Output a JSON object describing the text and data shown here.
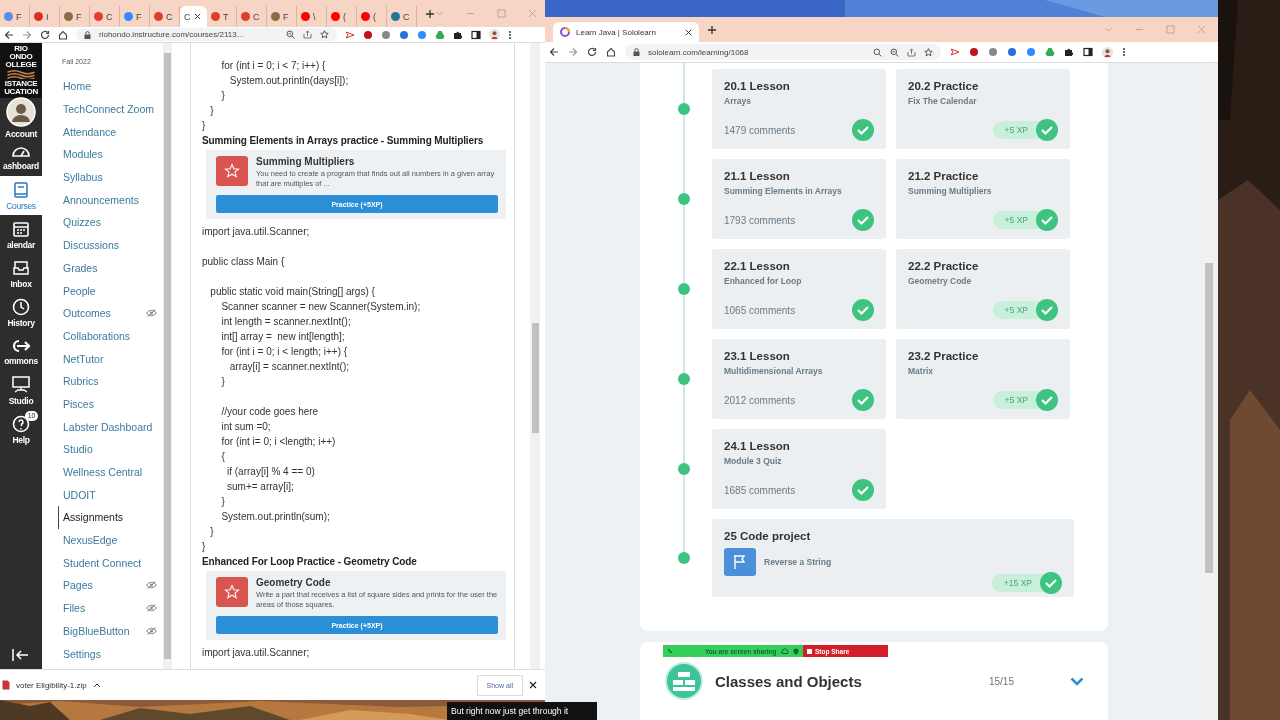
{
  "left_window": {
    "tabs": [
      {
        "title": "F",
        "selected": false,
        "color": "#5b8def"
      },
      {
        "title": "I",
        "selected": false,
        "color": "#d93025"
      },
      {
        "title": "F",
        "selected": false,
        "color": "#8a6d4a"
      },
      {
        "title": "C",
        "selected": false,
        "color": "#e03e2d"
      },
      {
        "title": "F",
        "selected": false,
        "color": "#2d8cff"
      },
      {
        "title": "C",
        "selected": false,
        "color": "#e03e2d"
      },
      {
        "title": "C",
        "selected": true
      },
      {
        "title": "T",
        "selected": false,
        "color": "#e03e2d"
      },
      {
        "title": "C",
        "selected": false,
        "color": "#e03e2d"
      },
      {
        "title": "F",
        "selected": false,
        "color": "#8a6d4a"
      },
      {
        "title": "\\",
        "selected": false,
        "color": "#ff0000"
      },
      {
        "title": "(",
        "selected": false,
        "color": "#ff0000"
      },
      {
        "title": "(",
        "selected": false,
        "color": "#ff0000"
      },
      {
        "title": "C",
        "selected": false,
        "color": "#21759b"
      }
    ],
    "address": "riohondo.instructure.com/courses/2113...",
    "global_nav": {
      "logo_top": [
        "RIO",
        "ONDO",
        "OLLEGE"
      ],
      "logo_bottom": [
        "ISTANCE",
        "UCATION"
      ],
      "items": [
        {
          "label": "Account",
          "selected": false
        },
        {
          "label": "ashboard",
          "selected": false
        },
        {
          "label": "Courses",
          "selected": true
        },
        {
          "label": "alendar",
          "selected": false
        },
        {
          "label": "Inbox",
          "selected": false
        },
        {
          "label": "History",
          "selected": false
        },
        {
          "label": "ommons",
          "selected": false
        },
        {
          "label": "Studio",
          "selected": false
        },
        {
          "label": "Help",
          "selected": false,
          "badge": "10"
        }
      ]
    },
    "course_nav": {
      "term": "Fall 2022",
      "items": [
        {
          "label": "Home",
          "selected": false,
          "hidden": false
        },
        {
          "label": "TechConnect Zoom",
          "selected": false,
          "hidden": false
        },
        {
          "label": "Attendance",
          "selected": false,
          "hidden": false
        },
        {
          "label": "Modules",
          "selected": false,
          "hidden": false
        },
        {
          "label": "Syllabus",
          "selected": false,
          "hidden": false
        },
        {
          "label": "Announcements",
          "selected": false,
          "hidden": false
        },
        {
          "label": "Quizzes",
          "selected": false,
          "hidden": false
        },
        {
          "label": "Discussions",
          "selected": false,
          "hidden": false
        },
        {
          "label": "Grades",
          "selected": false,
          "hidden": false
        },
        {
          "label": "People",
          "selected": false,
          "hidden": false
        },
        {
          "label": "Outcomes",
          "selected": false,
          "hidden": true
        },
        {
          "label": "Collaborations",
          "selected": false,
          "hidden": false
        },
        {
          "label": "NetTutor",
          "selected": false,
          "hidden": false
        },
        {
          "label": "Rubrics",
          "selected": false,
          "hidden": false
        },
        {
          "label": "Pisces",
          "selected": false,
          "hidden": false
        },
        {
          "label": "Labster Dashboard",
          "selected": false,
          "hidden": false
        },
        {
          "label": "Studio",
          "selected": false,
          "hidden": false
        },
        {
          "label": "Wellness Central",
          "selected": false,
          "hidden": false
        },
        {
          "label": "UDOIT",
          "selected": false,
          "hidden": false
        },
        {
          "label": "Assignments",
          "selected": true,
          "hidden": false
        },
        {
          "label": "NexusEdge",
          "selected": false,
          "hidden": false
        },
        {
          "label": "Student Connect",
          "selected": false,
          "hidden": false
        },
        {
          "label": "Pages",
          "selected": false,
          "hidden": true
        },
        {
          "label": "Files",
          "selected": false,
          "hidden": true
        },
        {
          "label": "BigBlueButton",
          "selected": false,
          "hidden": true
        },
        {
          "label": "Settings",
          "selected": false,
          "hidden": false
        }
      ]
    },
    "content": [
      {
        "kind": "code",
        "text": "       for (int i = 0; i < 7; i++) {"
      },
      {
        "kind": "code",
        "text": "          System.out.println(days[i]);"
      },
      {
        "kind": "code",
        "text": "       }"
      },
      {
        "kind": "code",
        "text": "   }"
      },
      {
        "kind": "code",
        "text": "}"
      },
      {
        "kind": "heading",
        "text": "Summing Elements in Arrays  practice - Summing Multipliers"
      },
      {
        "kind": "card",
        "title": "Summing Multipliers",
        "description": "You need to create a program that finds out all numbers in a given array that are multiples of ...",
        "button": "Practice (+5XP)"
      },
      {
        "kind": "code",
        "text": "import java.util.Scanner;"
      },
      {
        "kind": "blank"
      },
      {
        "kind": "code",
        "text": "public class Main {"
      },
      {
        "kind": "blank"
      },
      {
        "kind": "code",
        "text": "   public static void main(String[] args) {"
      },
      {
        "kind": "code",
        "text": "       Scanner scanner = new Scanner(System.in);"
      },
      {
        "kind": "code",
        "text": "       int length = scanner.nextInt();"
      },
      {
        "kind": "code",
        "text": "       int[] array =  new int[length];"
      },
      {
        "kind": "code",
        "text": "       for (int i = 0; i < length; i++) {"
      },
      {
        "kind": "code",
        "text": "          array[i] = scanner.nextInt();"
      },
      {
        "kind": "code",
        "text": "       }"
      },
      {
        "kind": "blank"
      },
      {
        "kind": "code",
        "text": "       //your code goes here"
      },
      {
        "kind": "code",
        "text": "       int sum =0;"
      },
      {
        "kind": "code",
        "text": "       for (int i= 0; i <length; i++)"
      },
      {
        "kind": "code",
        "text": "       {"
      },
      {
        "kind": "code",
        "text": "         if (array[i] % 4 == 0)"
      },
      {
        "kind": "code",
        "text": "         sum+= array[i];"
      },
      {
        "kind": "code",
        "text": "       }"
      },
      {
        "kind": "code",
        "text": "       System.out.println(sum);"
      },
      {
        "kind": "code",
        "text": "   }"
      },
      {
        "kind": "code",
        "text": "}"
      },
      {
        "kind": "heading",
        "text": "Enhanced For Loop Practice   - Geometry Code"
      },
      {
        "kind": "card",
        "title": "Geometry Code",
        "description": "Write a part that receives a list of square sides and prints for the user the areas of those squares.",
        "button": "Practice (+5XP)"
      },
      {
        "kind": "code",
        "text": "import java.util.Scanner;"
      }
    ],
    "download_bar": {
      "file": "voter Eligibility-1.zip",
      "show_all": "Show all"
    }
  },
  "right_window": {
    "tab": {
      "title": "Learn Java | Sololearn"
    },
    "address": "sololearn.com/learning/1068",
    "rows": [
      {
        "cards": [
          {
            "kind": "lesson",
            "title": "20.1 Lesson",
            "subtitle": "Arrays",
            "comments": "1479 comments",
            "completed": true
          },
          {
            "kind": "practice",
            "title": "20.2 Practice",
            "subtitle": "Fix The Calendar",
            "xp": "+5 XP",
            "completed": true
          }
        ]
      },
      {
        "cards": [
          {
            "kind": "lesson",
            "title": "21.1 Lesson",
            "subtitle": "Summing Elements in Arrays",
            "comments": "1793 comments",
            "completed": true
          },
          {
            "kind": "practice",
            "title": "21.2 Practice",
            "subtitle": "Summing Multipliers",
            "xp": "+5 XP",
            "completed": true
          }
        ]
      },
      {
        "cards": [
          {
            "kind": "lesson",
            "title": "22.1 Lesson",
            "subtitle": "Enhanced for Loop",
            "comments": "1065 comments",
            "completed": true
          },
          {
            "kind": "practice",
            "title": "22.2 Practice",
            "subtitle": "Geometry Code",
            "xp": "+5 XP",
            "completed": true
          }
        ]
      },
      {
        "cards": [
          {
            "kind": "lesson",
            "title": "23.1 Lesson",
            "subtitle": "Multidimensional Arrays",
            "comments": "2012 comments",
            "completed": true
          },
          {
            "kind": "practice",
            "title": "23.2 Practice",
            "subtitle": "Matrix",
            "xp": "+5 XP",
            "completed": true
          }
        ]
      },
      {
        "cards": [
          {
            "kind": "lesson",
            "title": "24.1 Lesson",
            "subtitle": "Module 3 Quiz",
            "comments": "1685 comments",
            "completed": true
          }
        ]
      },
      {
        "cards": [
          {
            "kind": "project",
            "title": "25 Code project",
            "subtitle": "Reverse a String",
            "xp": "+15 XP",
            "completed": true
          }
        ]
      }
    ],
    "next_module": {
      "title": "Classes and Objects",
      "progress": "15/15"
    }
  },
  "share_bar": {
    "status": "You are screen sharing",
    "stop": "Stop Share"
  },
  "caption": "But right now just get through it"
}
